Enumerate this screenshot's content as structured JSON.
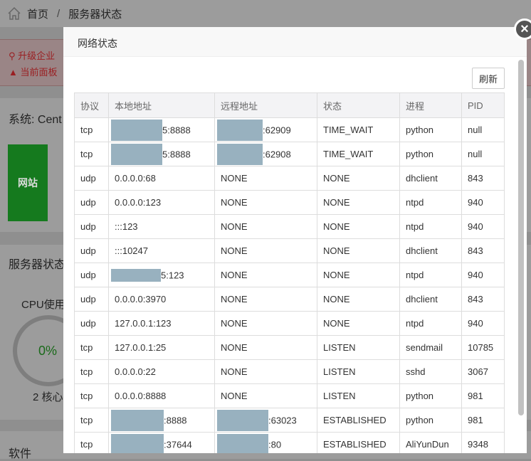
{
  "breadcrumb": {
    "home": "首页",
    "separator": "/",
    "current": "服务器状态"
  },
  "alerts": [
    "升级企业",
    "当前面板"
  ],
  "system_label": "系统: Cent",
  "site_box": "网站",
  "server_status_title": "服务器状态",
  "cpu": {
    "label": "CPU使用",
    "value": "0%",
    "cores": "2 核心"
  },
  "software_title": "软件",
  "modal": {
    "title": "网络状态",
    "refresh_label": "刷新",
    "close_label": "×",
    "columns": [
      "协议",
      "本地地址",
      "远程地址",
      "状态",
      "进程",
      "PID"
    ],
    "rows": [
      [
        "tcp",
        "5:8888",
        ":62909",
        "TIME_WAIT",
        "python",
        "null"
      ],
      [
        "tcp",
        "5:8888",
        ":62908",
        "TIME_WAIT",
        "python",
        "null"
      ],
      [
        "udp",
        "0.0.0.0:68",
        "NONE",
        "NONE",
        "dhclient",
        "843"
      ],
      [
        "udp",
        "0.0.0.0:123",
        "NONE",
        "NONE",
        "ntpd",
        "940"
      ],
      [
        "udp",
        ":::123",
        "NONE",
        "NONE",
        "ntpd",
        "940"
      ],
      [
        "udp",
        ":::10247",
        "NONE",
        "NONE",
        "dhclient",
        "843"
      ],
      [
        "udp",
        "5:123",
        "NONE",
        "NONE",
        "ntpd",
        "940"
      ],
      [
        "udp",
        "0.0.0.0:3970",
        "NONE",
        "NONE",
        "dhclient",
        "843"
      ],
      [
        "udp",
        "127.0.0.1:123",
        "NONE",
        "NONE",
        "ntpd",
        "940"
      ],
      [
        "tcp",
        "127.0.0.1:25",
        "NONE",
        "LISTEN",
        "sendmail",
        "10785"
      ],
      [
        "tcp",
        "0.0.0.0:22",
        "NONE",
        "LISTEN",
        "sshd",
        "3067"
      ],
      [
        "tcp",
        "0.0.0.0:8888",
        "NONE",
        "LISTEN",
        "python",
        "981"
      ],
      [
        "tcp",
        ":8888",
        ":63023",
        "ESTABLISHED",
        "python",
        "981"
      ],
      [
        "tcp",
        ":37644",
        ":80",
        "ESTABLISHED",
        "AliYunDun",
        "9348"
      ]
    ]
  }
}
